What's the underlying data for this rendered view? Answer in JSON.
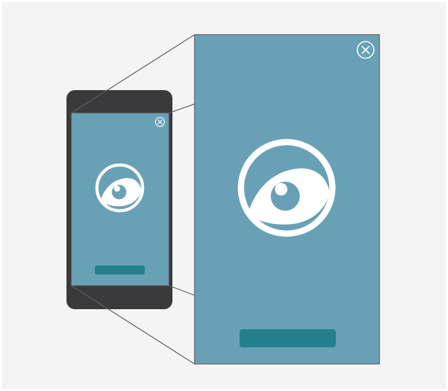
{
  "colors": {
    "page_background": "#f4f4f4",
    "phone_body": "#3a3a3c",
    "screen_fill": "#68a1b6",
    "button_fill": "#237f8c",
    "connector_line": "#5e5e5e",
    "icon_white": "#ffffff"
  },
  "icons": {
    "app_logo": "eye-icon",
    "dismiss": "close-icon"
  },
  "phone": {
    "primary_button_label": ""
  },
  "zoomed_screen": {
    "primary_button_label": ""
  }
}
